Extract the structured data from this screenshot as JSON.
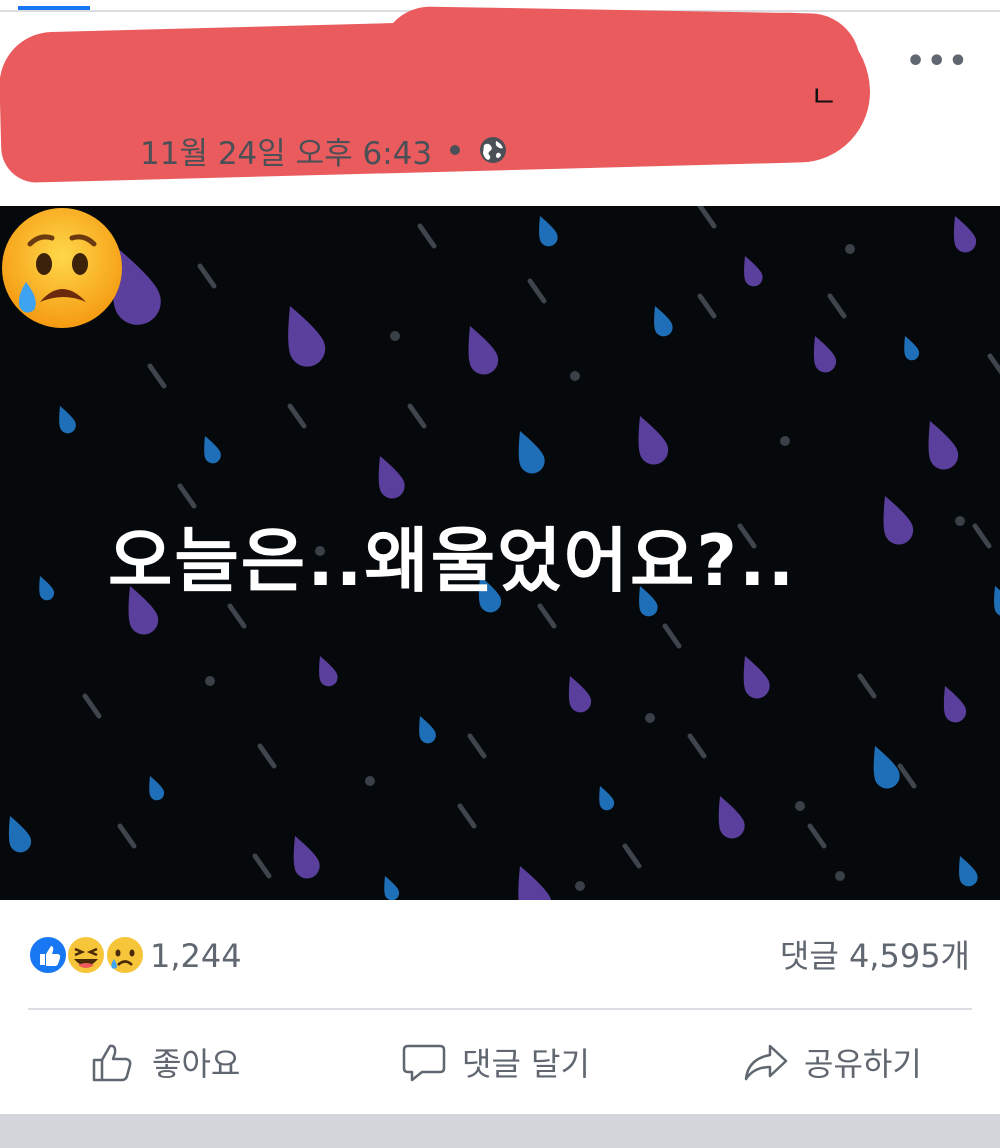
{
  "post": {
    "author_name_visible": "ㄴ",
    "timestamp": "11월 24일 오후 6:43",
    "more_label": "•••",
    "image_caption": "오늘은..왜울었어요?.."
  },
  "reactions": {
    "icons": [
      "like-icon",
      "haha-icon",
      "sad-icon"
    ],
    "count": "1,244",
    "comments": "댓글 4,595개"
  },
  "actions": {
    "like": "좋아요",
    "comment": "댓글 달기",
    "share": "공유하기"
  },
  "colors": {
    "redaction": "#ea5b5e",
    "like_blue": "#1877f2",
    "image_bg": "#06090c",
    "drop_purple": "#5b3f9c",
    "drop_blue": "#1f6fb8"
  }
}
